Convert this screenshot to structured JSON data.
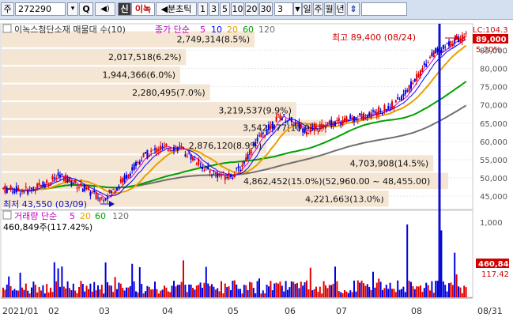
{
  "toolbar": {
    "market_label": "주",
    "code": "272290",
    "search_label": "Q",
    "new_label": "신",
    "stock_name": "이녹",
    "period_label": "분초틱",
    "minute_intervals": [
      "1",
      "3",
      "5",
      "10",
      "20",
      "30"
    ],
    "count_value": "3",
    "period_tabs": [
      "일",
      "주",
      "월",
      "년"
    ],
    "arrow_label": "⇕"
  },
  "price_pane": {
    "title": "이녹스첨단소재 매물대 수(10)",
    "ma_label": "종가 단순",
    "ma_periods": [
      "5",
      "10",
      "20",
      "60",
      "120"
    ],
    "ma_colors": {
      "ma5": "#d000d0",
      "ma10": "#0000ff",
      "ma20": "#e8a000",
      "ma60": "#00a000",
      "ma120": "#707070"
    },
    "high_note": "최고 89,400 (08/24)",
    "low_note": "최저 43,550 (03/09)",
    "current_price": "89,000",
    "lc_label": "LC:104.3",
    "pct_label": "5.20%",
    "range_note": "4,862,452(15.0%)(52,960.00 ~ 48,455.00)",
    "y_ticks": [
      "85,000",
      "80,000",
      "75,000",
      "70,000",
      "65,000",
      "60,000",
      "55,000",
      "50,000",
      "45,000"
    ],
    "y_min": 42000,
    "y_max": 90500,
    "profile": [
      {
        "label": "2,749,314(8.5%)",
        "vol": 8.5,
        "lo": 85550,
        "hi": 90400
      },
      {
        "label": "2,017,518(6.2%)",
        "vol": 6.2,
        "lo": 80700,
        "hi": 85550
      },
      {
        "label": "1,944,366(6.0%)",
        "vol": 6.0,
        "lo": 75850,
        "hi": 80700
      },
      {
        "label": "2,280,495(7.0%)",
        "vol": 7.0,
        "lo": 71000,
        "hi": 75850
      },
      {
        "label": "3,219,537(9.9%)",
        "vol": 9.9,
        "lo": 66150,
        "hi": 71000
      },
      {
        "label": "3,542,777(10.9%)",
        "vol": 10.9,
        "lo": 61300,
        "hi": 66150
      },
      {
        "label": "2,876,120(8.9%)",
        "vol": 8.9,
        "lo": 56450,
        "hi": 61300
      },
      {
        "label": "4,703,908(14.5%)",
        "vol": 14.5,
        "lo": 51600,
        "hi": 56450
      },
      {
        "label": "",
        "vol": 15.0,
        "lo": 46750,
        "hi": 51600
      },
      {
        "label": "4,221,663(13.0%)",
        "vol": 13.0,
        "lo": 41900,
        "hi": 46750
      }
    ]
  },
  "volume_pane": {
    "title": "거래량 단순",
    "ma_periods": [
      "5",
      "20",
      "60",
      "120"
    ],
    "value_label": "460,849주(117.42%)",
    "y_tick_top": "1,000",
    "current_volume": "460,84",
    "ratio_label": "117.42"
  },
  "x_axis": {
    "labels": [
      "2021/01",
      "02",
      "03",
      "04",
      "05",
      "06",
      "07",
      "08",
      "08/31"
    ]
  }
}
